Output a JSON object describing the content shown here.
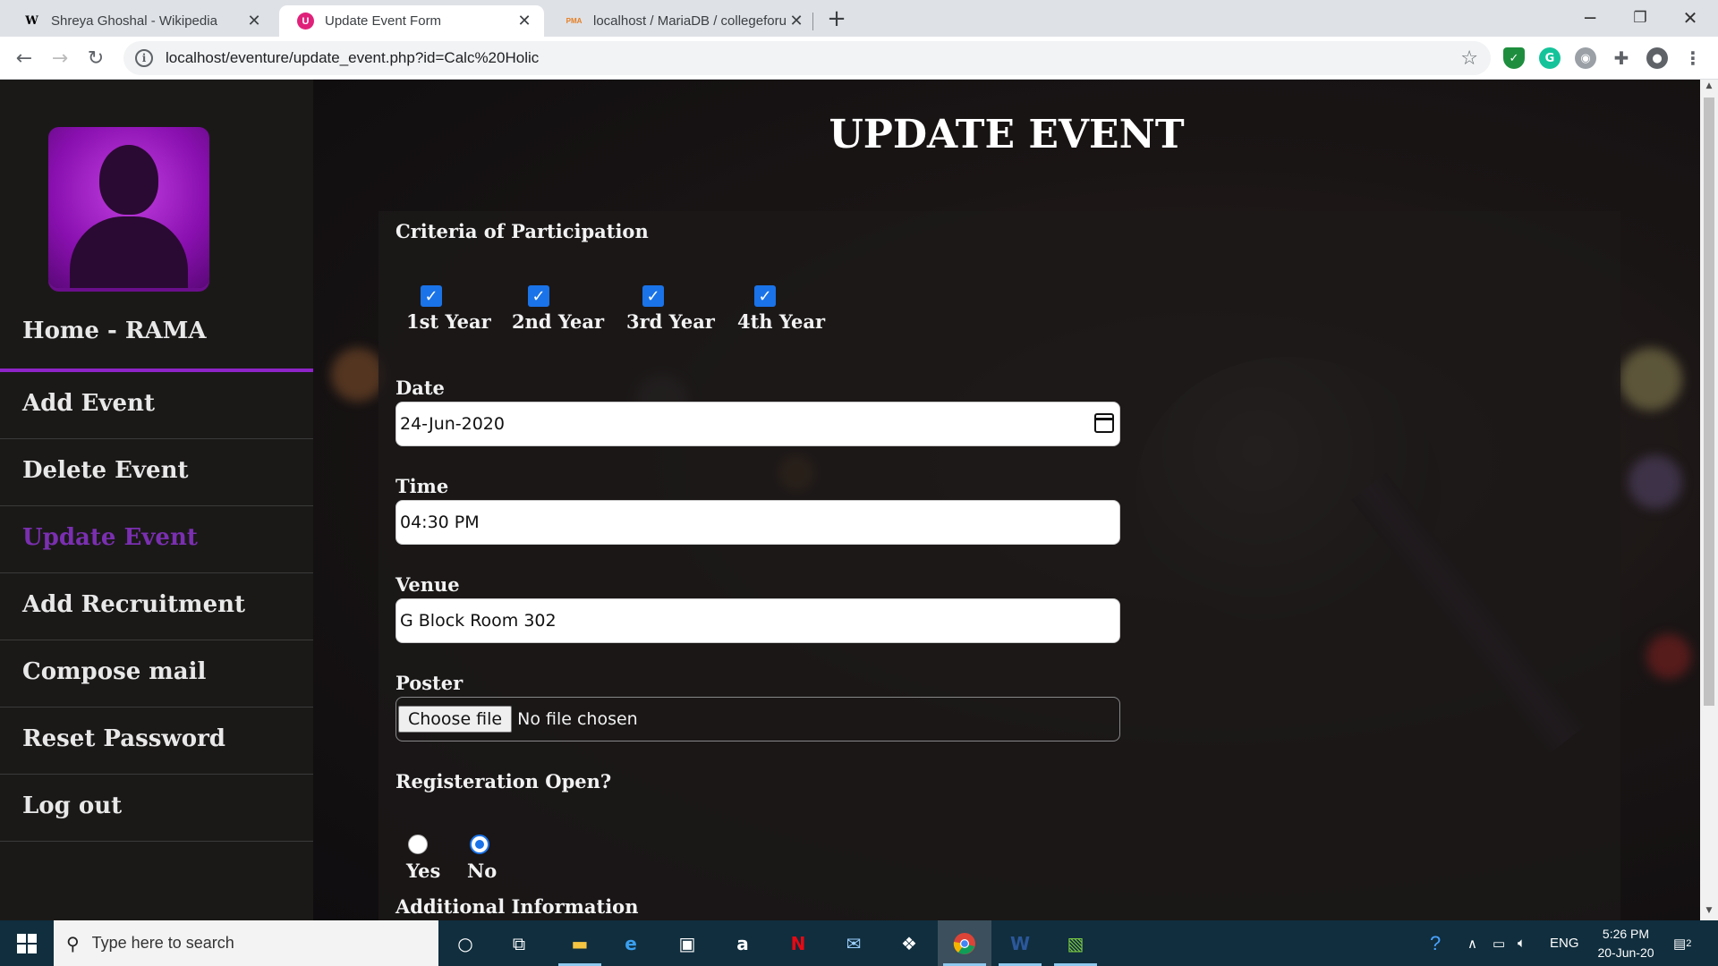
{
  "browser": {
    "tabs": [
      {
        "title": "Shreya Ghoshal - Wikipedia",
        "favicon": "W"
      },
      {
        "title": "Update Event Form",
        "favicon": "U"
      },
      {
        "title": "localhost / MariaDB / collegeforu",
        "favicon": "PMA"
      }
    ],
    "url": "localhost/eventure/update_event.php?id=Calc%20Holic"
  },
  "sidebar": {
    "home": "Home - RAMA",
    "items": [
      {
        "label": "Add Event"
      },
      {
        "label": "Delete Event"
      },
      {
        "label": "Update Event"
      },
      {
        "label": "Add Recruitment"
      },
      {
        "label": "Compose mail"
      },
      {
        "label": "Reset Password"
      },
      {
        "label": "Log out"
      }
    ],
    "active": "Update Event",
    "accent_color": "#7a2fb0"
  },
  "form": {
    "title": "UPDATE EVENT",
    "criteria_label": "Criteria of Participation",
    "years": [
      {
        "label": "1st Year",
        "checked": true
      },
      {
        "label": "2nd Year",
        "checked": true
      },
      {
        "label": "3rd Year",
        "checked": true
      },
      {
        "label": "4th Year",
        "checked": true
      }
    ],
    "date_label": "Date",
    "date_value": "24-Jun-2020",
    "time_label": "Time",
    "time_value": "04:30 PM",
    "venue_label": "Venue",
    "venue_value": "G Block Room 302",
    "poster_label": "Poster",
    "file_button": "Choose file",
    "file_status": "No file chosen",
    "registration_label": "Registeration Open?",
    "registration_options": [
      {
        "label": "Yes",
        "selected": false
      },
      {
        "label": "No",
        "selected": true
      }
    ],
    "additional_label": "Additional Information"
  },
  "taskbar": {
    "search_placeholder": "Type here to search",
    "language": "ENG",
    "time": "5:26 PM",
    "date": "20-Jun-20",
    "notification_count": "2"
  }
}
